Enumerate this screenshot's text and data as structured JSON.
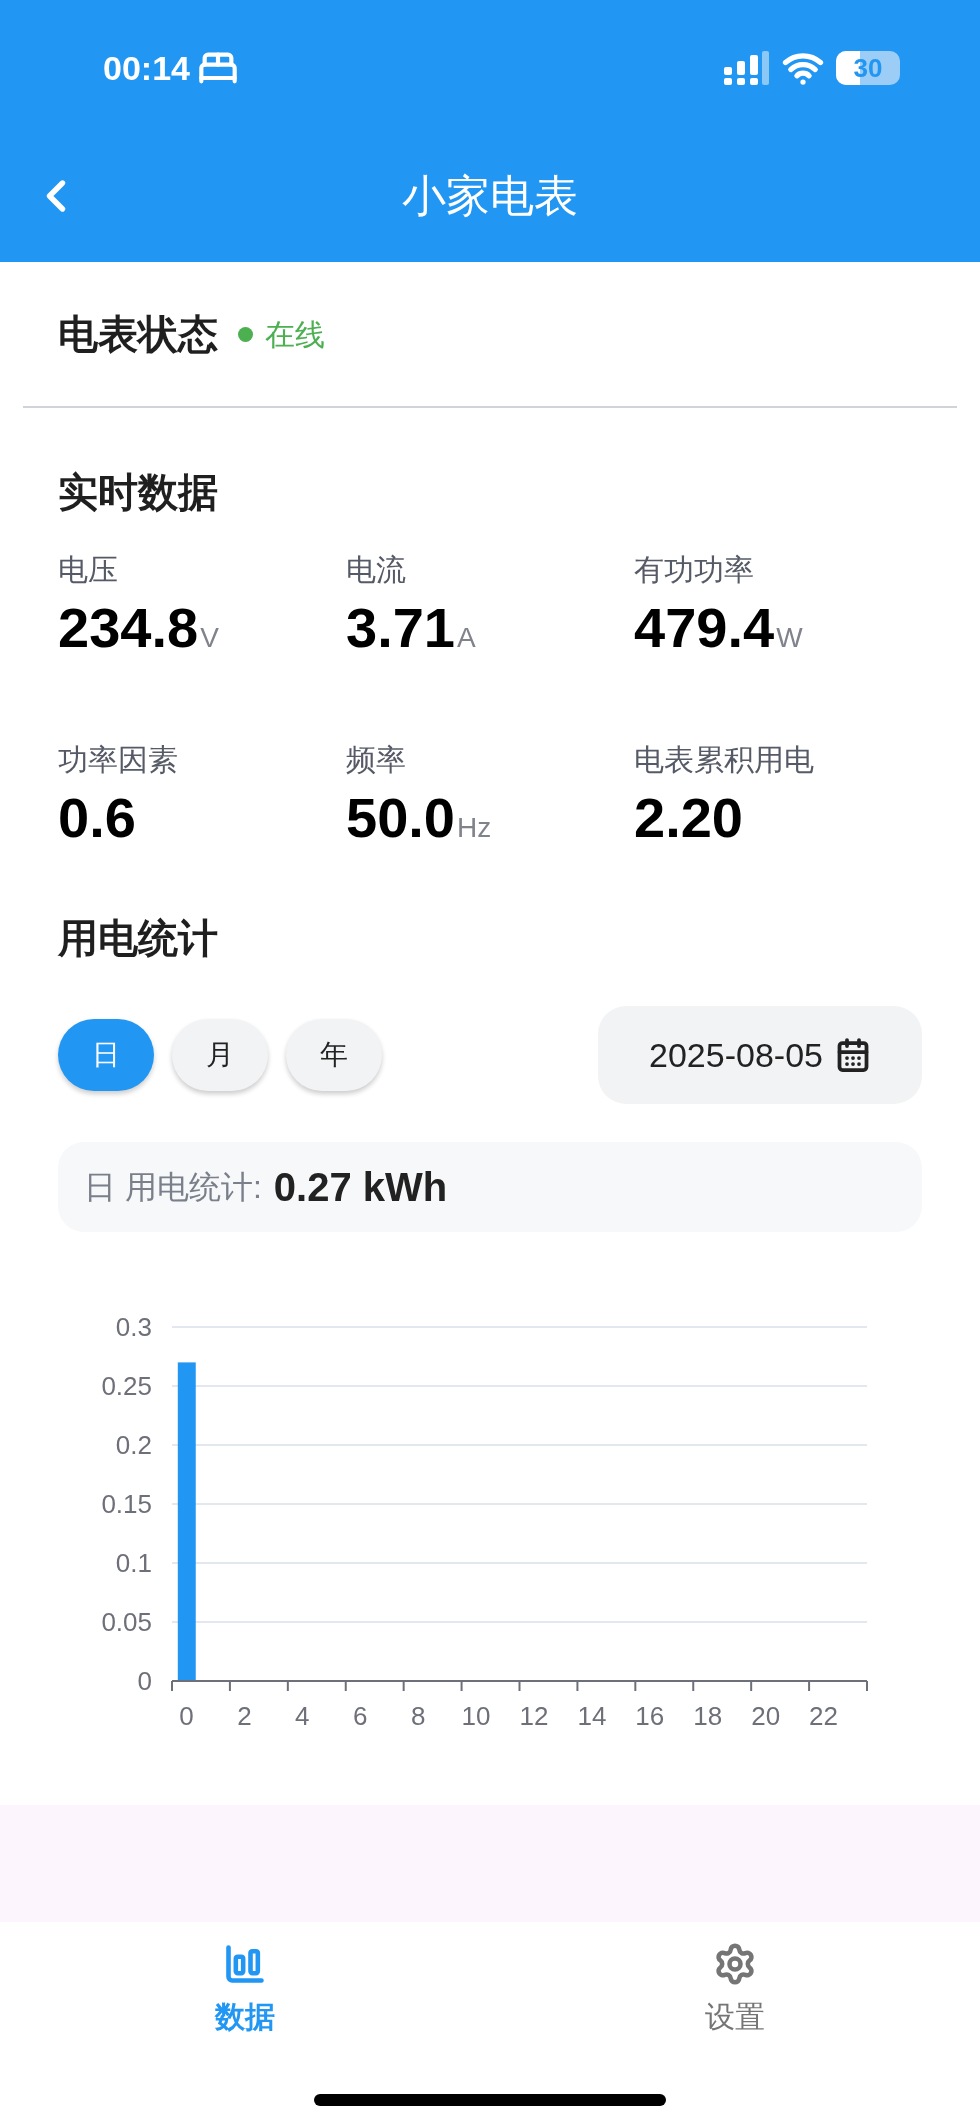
{
  "status_bar": {
    "time": "00:14",
    "battery": "30"
  },
  "header": {
    "title": "小家电表"
  },
  "meter_status": {
    "title": "电表状态",
    "status": "在线",
    "online": true
  },
  "realtime": {
    "title": "实时数据",
    "metrics": [
      {
        "label": "电压",
        "value": "234.8",
        "unit": "V"
      },
      {
        "label": "电流",
        "value": "3.71",
        "unit": "A"
      },
      {
        "label": "有功功率",
        "value": "479.4",
        "unit": "W"
      },
      {
        "label": "功率因素",
        "value": "0.6"
      },
      {
        "label": "频率",
        "value": "50.0",
        "unit": "Hz"
      },
      {
        "label": "电表累积用电",
        "value": "2.20"
      }
    ]
  },
  "usage": {
    "title": "用电统计",
    "periods": [
      {
        "label": "日",
        "selected": true
      },
      {
        "label": "月",
        "selected": false
      },
      {
        "label": "年",
        "selected": false
      }
    ],
    "date": "2025-08-05",
    "summary_label": "日 用电统计:",
    "summary_value": "0.27 kWh",
    "chart_data": {
      "type": "bar",
      "categories": [
        "0",
        "2",
        "4",
        "6",
        "8",
        "10",
        "12",
        "14",
        "16",
        "18",
        "20",
        "22"
      ],
      "values": [
        0.27,
        0,
        0,
        0,
        0,
        0,
        0,
        0,
        0,
        0,
        0,
        0
      ],
      "ylim": [
        0,
        0.3
      ],
      "yticks": [
        0,
        0.05,
        0.1,
        0.15,
        0.2,
        0.25,
        0.3
      ],
      "grid": true
    }
  },
  "tabs": [
    {
      "label": "数据",
      "kind": "chart",
      "selected": true
    },
    {
      "label": "设置",
      "kind": "settings",
      "selected": false
    }
  ]
}
